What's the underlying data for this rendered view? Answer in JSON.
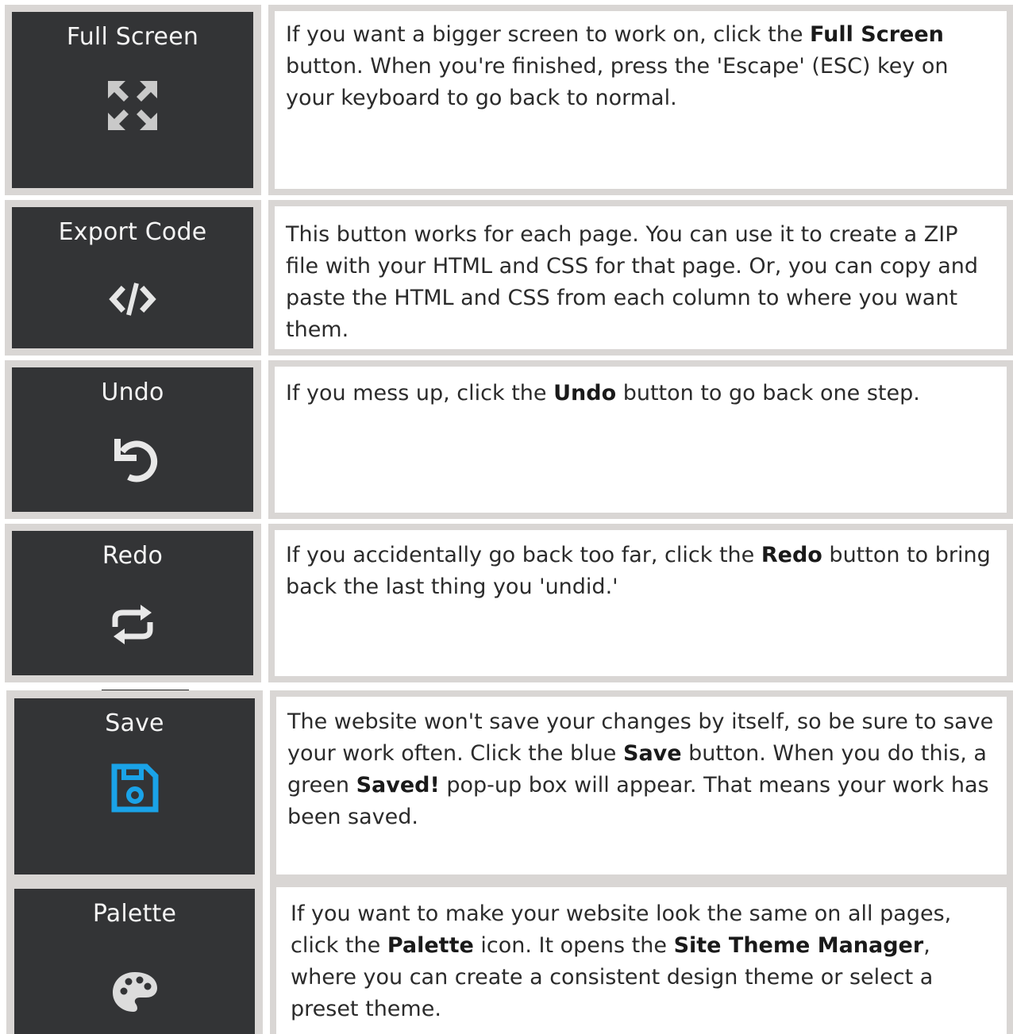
{
  "rows": [
    {
      "label": "Full Screen",
      "icon": "fullscreen-icon",
      "text": [
        {
          "t": "If you want a bigger screen to work on, click the "
        },
        {
          "t": "Full Screen",
          "b": true
        },
        {
          "t": " button. When you're finished, press the 'Escape' (ESC) key on your keyboard to go back to normal."
        }
      ]
    },
    {
      "label": "Export Code",
      "icon": "code-icon",
      "text": [
        {
          "t": "This button works for each page. You can use it to create a ZIP file with your HTML and CSS for that page. Or, you can copy and paste the HTML and CSS from each column to where you want them."
        }
      ]
    },
    {
      "label": "Undo",
      "icon": "undo-icon",
      "text": [
        {
          "t": "If you mess up, click the "
        },
        {
          "t": "Undo",
          "b": true
        },
        {
          "t": " button to go back one step."
        }
      ]
    },
    {
      "label": "Redo",
      "icon": "redo-icon",
      "text": [
        {
          "t": "If you accidentally go back too far, click the "
        },
        {
          "t": "Redo",
          "b": true
        },
        {
          "t": " button to bring back the last thing you 'undid.'"
        }
      ]
    },
    {
      "label": "Save",
      "icon": "save-icon",
      "text": [
        {
          "t": "The website won't save your changes by itself, so be sure to save your work often. Click the blue "
        },
        {
          "t": "Save",
          "b": true
        },
        {
          "t": " button. When you do this, a green "
        },
        {
          "t": "Saved!",
          "b": true
        },
        {
          "t": " pop-up box will appear. That means your work has been saved."
        }
      ]
    },
    {
      "label": "Palette",
      "icon": "palette-icon",
      "text": [
        {
          "t": " If you want to make your website look the same on all pages, click the "
        },
        {
          "t": "Palette",
          "b": true
        },
        {
          "t": " icon. It opens the "
        },
        {
          "t": "Site Theme Manager",
          "b": true
        },
        {
          "t": ", where you can create a consistent design theme or select a preset theme."
        }
      ]
    }
  ],
  "colors": {
    "tile_bg": "#333436",
    "border": "#d9d6d4",
    "save_blue": "#1aa3e8"
  }
}
